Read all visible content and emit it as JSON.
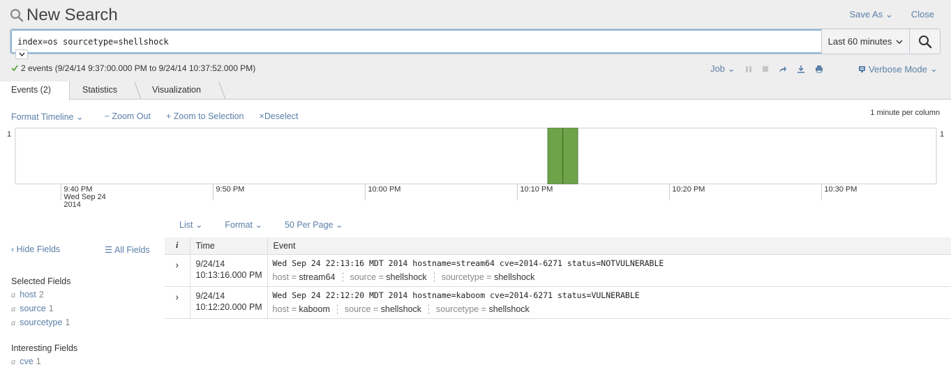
{
  "header": {
    "title": "New Search",
    "save_as": "Save As",
    "close": "Close"
  },
  "search": {
    "query": "index=os sourcetype=shellshock",
    "time_range": "Last 60 minutes"
  },
  "status": {
    "text": "2 events (9/24/14 9:37:00.000 PM to 9/24/14 10:37:52.000 PM)"
  },
  "job": {
    "label": "Job",
    "mode": "Verbose Mode"
  },
  "tabs": [
    {
      "label": "Events (2)",
      "active": true
    },
    {
      "label": "Statistics",
      "active": false
    },
    {
      "label": "Visualization",
      "active": false
    }
  ],
  "timeline": {
    "format": "Format Timeline",
    "zoom_out": "Zoom Out",
    "zoom_selection": "Zoom to Selection",
    "deselect": "Deselect",
    "per_column": "1 minute per column",
    "y_max_left": "1",
    "y_max_right": "1"
  },
  "chart_data": {
    "type": "bar",
    "categories": [
      "10:12 PM",
      "10:13 PM"
    ],
    "values": [
      1,
      1
    ],
    "x_ticks": [
      {
        "label": "9:40 PM",
        "sub1": "Wed Sep 24",
        "sub2": "2014"
      },
      {
        "label": "9:50 PM"
      },
      {
        "label": "10:00 PM"
      },
      {
        "label": "10:10 PM"
      },
      {
        "label": "10:20 PM"
      },
      {
        "label": "10:30 PM"
      }
    ],
    "ylim": [
      0,
      1
    ],
    "bar_color": "#6fa34a",
    "grid": false
  },
  "list_controls": {
    "list": "List",
    "format": "Format",
    "per_page": "50 Per Page"
  },
  "sidebar": {
    "hide_fields": "Hide Fields",
    "all_fields": "All Fields",
    "selected_heading": "Selected Fields",
    "selected": [
      {
        "type": "a",
        "name": "host",
        "count": "2"
      },
      {
        "type": "a",
        "name": "source",
        "count": "1"
      },
      {
        "type": "a",
        "name": "sourcetype",
        "count": "1"
      }
    ],
    "interesting_heading": "Interesting Fields",
    "interesting": [
      {
        "type": "a",
        "name": "cve",
        "count": "1"
      }
    ]
  },
  "table": {
    "col_i": "i",
    "col_time": "Time",
    "col_event": "Event",
    "rows": [
      {
        "date": "9/24/14",
        "time": "10:13:16.000 PM",
        "raw": "Wed Sep 24 22:13:16 MDT 2014 hostname=stream64 cve=2014-6271 status=NOTVULNERABLE",
        "host_k": "host =",
        "host_v": "stream64",
        "source_k": "source =",
        "source_v": "shellshock",
        "st_k": "sourcetype =",
        "st_v": "shellshock"
      },
      {
        "date": "9/24/14",
        "time": "10:12:20.000 PM",
        "raw": "Wed Sep 24 22:12:20 MDT 2014 hostname=kaboom cve=2014-6271 status=VULNERABLE",
        "host_k": "host =",
        "host_v": "kaboom",
        "source_k": "source =",
        "source_v": "shellshock",
        "st_k": "sourcetype =",
        "st_v": "shellshock"
      }
    ]
  }
}
